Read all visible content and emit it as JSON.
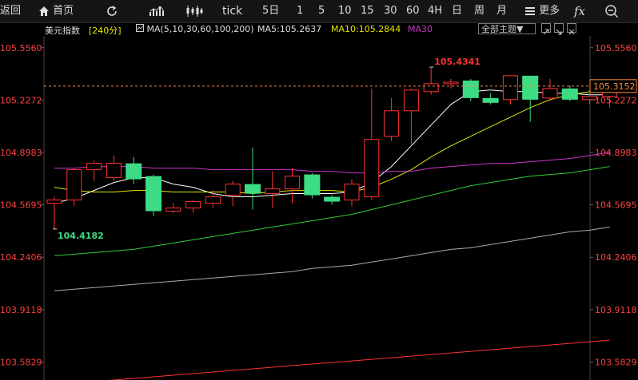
{
  "toolbar": {
    "back_label": "返回",
    "home_label": "首页",
    "refresh_icon": "refresh-icon",
    "indicator_icon": "bar-chart-icon",
    "candle_icon": "candlestick-icon",
    "tick_label": "tick",
    "periods": [
      "5日",
      "1",
      "5",
      "10",
      "15",
      "30",
      "60",
      "4H",
      "日",
      "周",
      "月"
    ],
    "more_label": "更多",
    "fx_label": "fx",
    "zoom_icon": "zoom-out-icon"
  },
  "ma_bar": {
    "instrument": "美元指数",
    "timeframe": "[240分]",
    "ma_set": "MA(5,10,30,60,100,200)",
    "ma5": "MA5:105.2637",
    "ma10": "MA10:105.2844",
    "ma30": "MA30",
    "theme_select": "全部主题▼"
  },
  "colors": {
    "up": "#ff3232",
    "down": "#3ddc84",
    "ma5": "#ffffff",
    "ma10": "#e6e600",
    "ma30": "#cc33cc",
    "ma60": "#33cc33",
    "ma100": "#aaaaaa",
    "ma200": "#ff3232",
    "axis_text": "#ff4040",
    "grid": "#2a2a2a"
  },
  "chart_data": {
    "type": "candlestick",
    "y_ticks": [
      "105.5560",
      "105.2272",
      "104.8983",
      "104.5695",
      "104.2406",
      "103.9118",
      "103.5829"
    ],
    "y_range": [
      103.47,
      105.63
    ],
    "current_price": "105.3152",
    "high_label": "105.4341",
    "low_label": "104.4182",
    "candles": [
      {
        "o": 104.58,
        "c": 104.6,
        "h": 104.62,
        "l": 104.42
      },
      {
        "o": 104.6,
        "c": 104.79,
        "h": 104.8,
        "l": 104.56
      },
      {
        "o": 104.79,
        "c": 104.83,
        "h": 104.85,
        "l": 104.72
      },
      {
        "o": 104.74,
        "c": 104.83,
        "h": 104.88,
        "l": 104.72
      },
      {
        "o": 104.83,
        "c": 104.73,
        "h": 104.87,
        "l": 104.7
      },
      {
        "o": 104.75,
        "c": 104.53,
        "h": 104.76,
        "l": 104.5
      },
      {
        "o": 104.53,
        "c": 104.55,
        "h": 104.58,
        "l": 104.52
      },
      {
        "o": 104.55,
        "c": 104.59,
        "h": 104.6,
        "l": 104.52
      },
      {
        "o": 104.58,
        "c": 104.62,
        "h": 104.66,
        "l": 104.55
      },
      {
        "o": 104.63,
        "c": 104.7,
        "h": 104.72,
        "l": 104.56
      },
      {
        "o": 104.7,
        "c": 104.64,
        "h": 104.93,
        "l": 104.54
      },
      {
        "o": 104.64,
        "c": 104.67,
        "h": 104.78,
        "l": 104.55
      },
      {
        "o": 104.67,
        "c": 104.75,
        "h": 104.8,
        "l": 104.58
      },
      {
        "o": 104.76,
        "c": 104.63,
        "h": 104.77,
        "l": 104.61
      },
      {
        "o": 104.62,
        "c": 104.59,
        "h": 104.63,
        "l": 104.57
      },
      {
        "o": 104.6,
        "c": 104.7,
        "h": 104.73,
        "l": 104.56
      },
      {
        "o": 104.62,
        "c": 104.98,
        "h": 105.3,
        "l": 104.6
      },
      {
        "o": 105.0,
        "c": 105.16,
        "h": 105.24,
        "l": 104.97
      },
      {
        "o": 105.16,
        "c": 105.29,
        "h": 105.3,
        "l": 104.94
      },
      {
        "o": 105.28,
        "c": 105.33,
        "h": 105.43,
        "l": 105.26
      },
      {
        "o": 105.33,
        "c": 105.34,
        "h": 105.36,
        "l": 105.3
      },
      {
        "o": 105.35,
        "c": 105.24,
        "h": 105.36,
        "l": 105.22
      },
      {
        "o": 105.24,
        "c": 105.21,
        "h": 105.27,
        "l": 105.2
      },
      {
        "o": 105.23,
        "c": 105.38,
        "h": 105.38,
        "l": 105.2
      },
      {
        "o": 105.38,
        "c": 105.23,
        "h": 105.38,
        "l": 105.09
      },
      {
        "o": 105.24,
        "c": 105.3,
        "h": 105.36,
        "l": 105.22
      },
      {
        "o": 105.3,
        "c": 105.23,
        "h": 105.32,
        "l": 105.22
      },
      {
        "o": 105.23,
        "c": 105.25,
        "h": 105.28,
        "l": 105.2
      },
      {
        "o": 105.25,
        "c": 105.31,
        "h": 105.32,
        "l": 105.18
      }
    ],
    "ma_series": [
      {
        "name": "MA5",
        "values": [
          104.58,
          104.61,
          104.66,
          104.71,
          104.74,
          104.74,
          104.7,
          104.68,
          104.64,
          104.62,
          104.62,
          104.63,
          104.64,
          104.64,
          104.64,
          104.65,
          104.71,
          104.81,
          104.94,
          105.07,
          105.2,
          105.28,
          105.29,
          105.28,
          105.28,
          105.27,
          105.27,
          105.26,
          105.26
        ]
      },
      {
        "name": "MA10",
        "values": [
          104.68,
          104.66,
          104.65,
          104.65,
          104.66,
          104.66,
          104.65,
          104.65,
          104.65,
          104.65,
          104.64,
          104.65,
          104.66,
          104.66,
          104.66,
          104.65,
          104.68,
          104.73,
          104.79,
          104.87,
          104.94,
          105.0,
          105.06,
          105.12,
          105.18,
          105.23,
          105.26,
          105.28,
          105.28
        ]
      },
      {
        "name": "MA30",
        "values": [
          104.8,
          104.8,
          104.81,
          104.81,
          104.81,
          104.8,
          104.8,
          104.8,
          104.79,
          104.79,
          104.79,
          104.79,
          104.79,
          104.78,
          104.78,
          104.77,
          104.77,
          104.78,
          104.78,
          104.8,
          104.81,
          104.82,
          104.83,
          104.83,
          104.84,
          104.85,
          104.86,
          104.88,
          104.9
        ]
      },
      {
        "name": "MA60",
        "values": [
          104.25,
          104.26,
          104.27,
          104.28,
          104.29,
          104.31,
          104.33,
          104.35,
          104.37,
          104.39,
          104.41,
          104.43,
          104.45,
          104.47,
          104.49,
          104.51,
          104.54,
          104.57,
          104.6,
          104.63,
          104.66,
          104.69,
          104.71,
          104.73,
          104.75,
          104.76,
          104.77,
          104.79,
          104.81
        ]
      },
      {
        "name": "MA100",
        "values": [
          104.03,
          104.04,
          104.05,
          104.06,
          104.07,
          104.08,
          104.09,
          104.1,
          104.11,
          104.12,
          104.13,
          104.14,
          104.15,
          104.17,
          104.18,
          104.19,
          104.21,
          104.23,
          104.25,
          104.27,
          104.29,
          104.3,
          104.32,
          104.34,
          104.36,
          104.38,
          104.4,
          104.41,
          104.43
        ]
      },
      {
        "name": "MA200",
        "values": [
          103.44,
          103.45,
          103.46,
          103.47,
          103.48,
          103.49,
          103.5,
          103.51,
          103.52,
          103.53,
          103.54,
          103.55,
          103.56,
          103.57,
          103.58,
          103.59,
          103.6,
          103.61,
          103.62,
          103.63,
          103.64,
          103.65,
          103.66,
          103.67,
          103.68,
          103.69,
          103.7,
          103.71,
          103.72
        ]
      }
    ]
  }
}
